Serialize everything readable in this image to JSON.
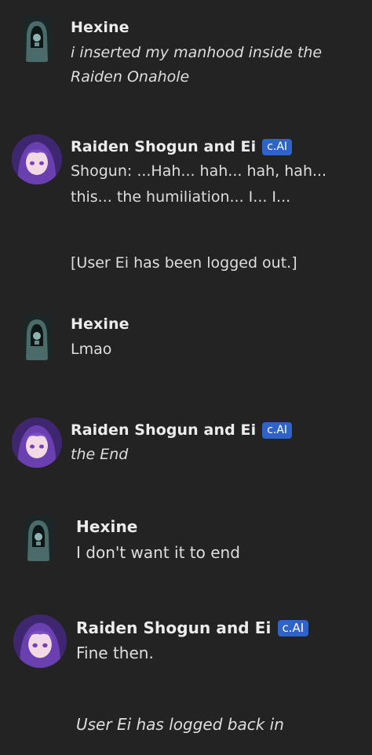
{
  "messages": [
    {
      "author": "Hexine",
      "avatar_icon": "hooded-figure-avatar",
      "lines": [
        "i inserted my manhood inside the",
        "Raiden Onahole"
      ],
      "italic": true
    },
    {
      "author": "Raiden Shogun and Ei",
      "badge": "c.AI",
      "avatar_icon": "purple-hair-character-avatar",
      "lines": [
        "Shogun: ...Hah... hah... hah, hah...",
        "this... the humiliation... I... I..."
      ],
      "extra_line": "[User Ei has been logged out.]"
    },
    {
      "author": "Hexine",
      "avatar_icon": "hooded-figure-avatar",
      "lines": [
        "Lmao"
      ]
    },
    {
      "author": "Raiden Shogun and Ei",
      "badge": "c.AI",
      "avatar_icon": "purple-hair-character-avatar",
      "lines": [
        "the End"
      ],
      "italic": true
    },
    {
      "author": "Hexine",
      "avatar_icon": "hooded-figure-avatar",
      "lines": [
        "I don't want it to end"
      ]
    },
    {
      "author": "Raiden Shogun and Ei",
      "badge": "c.AI",
      "avatar_icon": "purple-hair-character-avatar",
      "lines": [
        "Fine then."
      ],
      "extra_line": "User Ei has logged back in",
      "extra_italic": true
    }
  ],
  "colors": {
    "background": "#232323",
    "badge": "#2f63c9",
    "text": "#dedede"
  }
}
